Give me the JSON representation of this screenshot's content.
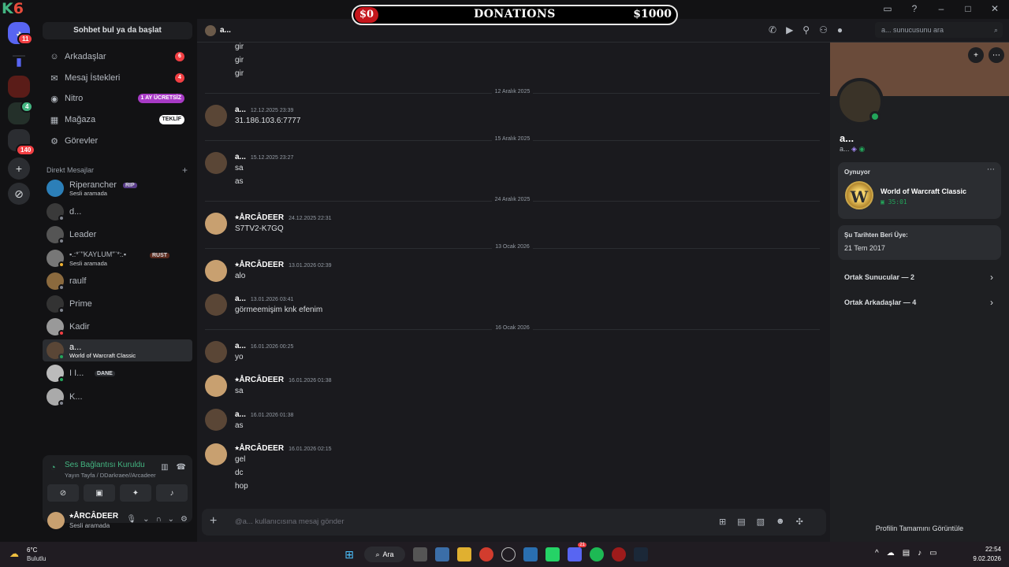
{
  "titlebar": {
    "logo_k": "K",
    "logo_6": "6",
    "title": "Direkt Mesajlar"
  },
  "donations": {
    "left": "$0",
    "title": "DONATIONS",
    "right": "$1000"
  },
  "rail": {
    "home_badge": "11",
    "server_badge": "140",
    "small_badge": "4"
  },
  "sidebar": {
    "find_button": "Sohbet bul ya da başlat",
    "nav": [
      {
        "label": "Arkadaşlar",
        "badge": "6"
      },
      {
        "label": "Mesaj İstekleri",
        "badge": "4"
      },
      {
        "label": "Nitro",
        "pill": "1 AY ÜCRETSİZ"
      },
      {
        "label": "Mağaza",
        "pill": "TEKLİF"
      },
      {
        "label": "Görevler"
      }
    ],
    "dm_header": "Direkt Mesajlar",
    "dms": [
      {
        "name": "Riperancher",
        "tag": "RIP",
        "sub": "Sesli aramada"
      },
      {
        "name": "d..."
      },
      {
        "name": "Leader"
      },
      {
        "name": "▪.:*¨\"KAYLUM\"¨*:.▪",
        "tag": "RUST",
        "sub": "Sesli aramada"
      },
      {
        "name": "raulf"
      },
      {
        "name": "Prime"
      },
      {
        "name": "Kadir"
      },
      {
        "name": "a...",
        "sub": "World of Warcraft Classic"
      },
      {
        "name": "I I...",
        "tag": "DANE"
      },
      {
        "name": "K..."
      }
    ]
  },
  "voice": {
    "status": "Ses Bağlantısı Kuruldu",
    "channel": "Yayın Tayfa / DDarkraee//Arcadeer"
  },
  "user": {
    "name": "⭑ÅRCÂDEER",
    "status": "Sesli aramada"
  },
  "chat": {
    "header_name": "a...",
    "search_placeholder": "a... sunucusunu ara",
    "composer_placeholder": "@a... kullanıcısına mesaj gönder",
    "top_lines": [
      "gir",
      "gir",
      "gir"
    ],
    "dividers": [
      "12 Aralık 2025",
      "15 Aralık 2025",
      "24 Aralık 2025",
      "13 Ocak 2026",
      "16 Ocak 2026"
    ],
    "messages": [
      {
        "author": "a...",
        "time": "12.12.2025 23:39",
        "lines": [
          "31.186.103.6:7777"
        ]
      },
      {
        "author": "a...",
        "time": "15.12.2025 23:27",
        "lines": [
          "sa",
          "as"
        ]
      },
      {
        "author": "⭑ÅRCÂDEER",
        "time": "24.12.2025 22:31",
        "lines": [
          "S7TV2-K7GQ"
        ]
      },
      {
        "author": "⭑ÅRCÂDEER",
        "time": "13.01.2026 02:39",
        "lines": [
          "alo"
        ]
      },
      {
        "author": "a...",
        "time": "13.01.2026 03:41",
        "lines": [
          "görmeemişim knk efenim"
        ]
      },
      {
        "author": "a...",
        "time": "16.01.2026 00:25",
        "lines": [
          "yo"
        ]
      },
      {
        "author": "⭑ÅRCÂDEER",
        "time": "16.01.2026 01:38",
        "lines": [
          "sa"
        ]
      },
      {
        "author": "a...",
        "time": "16.01.2026 01:38",
        "lines": [
          "as"
        ]
      },
      {
        "author": "⭑ÅRCÂDEER",
        "time": "16.01.2026 02:15",
        "lines": [
          "gel",
          "dc",
          "hop"
        ]
      }
    ]
  },
  "profile": {
    "name": "a...",
    "username": "a...",
    "playing_label": "Oynuyor",
    "game": "World of Warcraft Classic",
    "game_time": "35:01",
    "member_since_label": "Şu Tarihten Beri Üye:",
    "member_since": "21 Tem 2017",
    "mutual_servers": "Ortak Sunucular — 2",
    "mutual_friends": "Ortak Arkadaşlar — 4",
    "full_profile": "Profilin Tamamını Görüntüle"
  },
  "taskbar": {
    "temp": "6°C",
    "weather": "Bulutlu",
    "search": "Ara",
    "discord_badge": "21",
    "time": "22:54",
    "date": "9.02.2026"
  },
  "colors": {
    "accent": "#5865f2",
    "online": "#23a55a",
    "badge": "#f23f43",
    "nitro": "#a83ac6"
  }
}
